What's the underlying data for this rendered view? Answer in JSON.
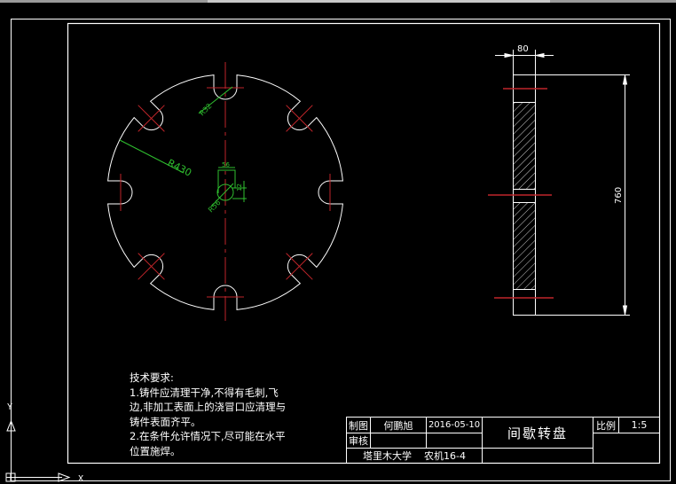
{
  "colors": {
    "background": "#000000",
    "outline": "#ffffff",
    "centerline": "#c0252a",
    "dimension": "#2fbf2f"
  },
  "front_view": {
    "radius_label": "R430",
    "slot_radius_label": "R32",
    "hole_radius_label": "R56",
    "keyway_width_label": "56",
    "keyway_depth_label": "12"
  },
  "side_view": {
    "thickness_label": "80",
    "diameter_label": "760"
  },
  "notes": {
    "title": "技术要求:",
    "lines": [
      "1.铸件应清理干净,不得有毛刺,飞",
      "边,非加工表面上的浇冒口应清理与",
      "铸件表面齐平。",
      "2.在条件允许情况下,尽可能在水平",
      "位置施焊。"
    ]
  },
  "title_block": {
    "drawn_label": "制图",
    "drawn_by": "何鹏旭",
    "date": "2016-05-10",
    "checked_label": "审核",
    "drawing_title": "间歇转盘",
    "scale_label": "比例",
    "scale": "1:5",
    "school": "塔里木大学",
    "class": "农机16-4"
  },
  "ucs": {
    "x_label": "X",
    "y_label": "Y"
  }
}
